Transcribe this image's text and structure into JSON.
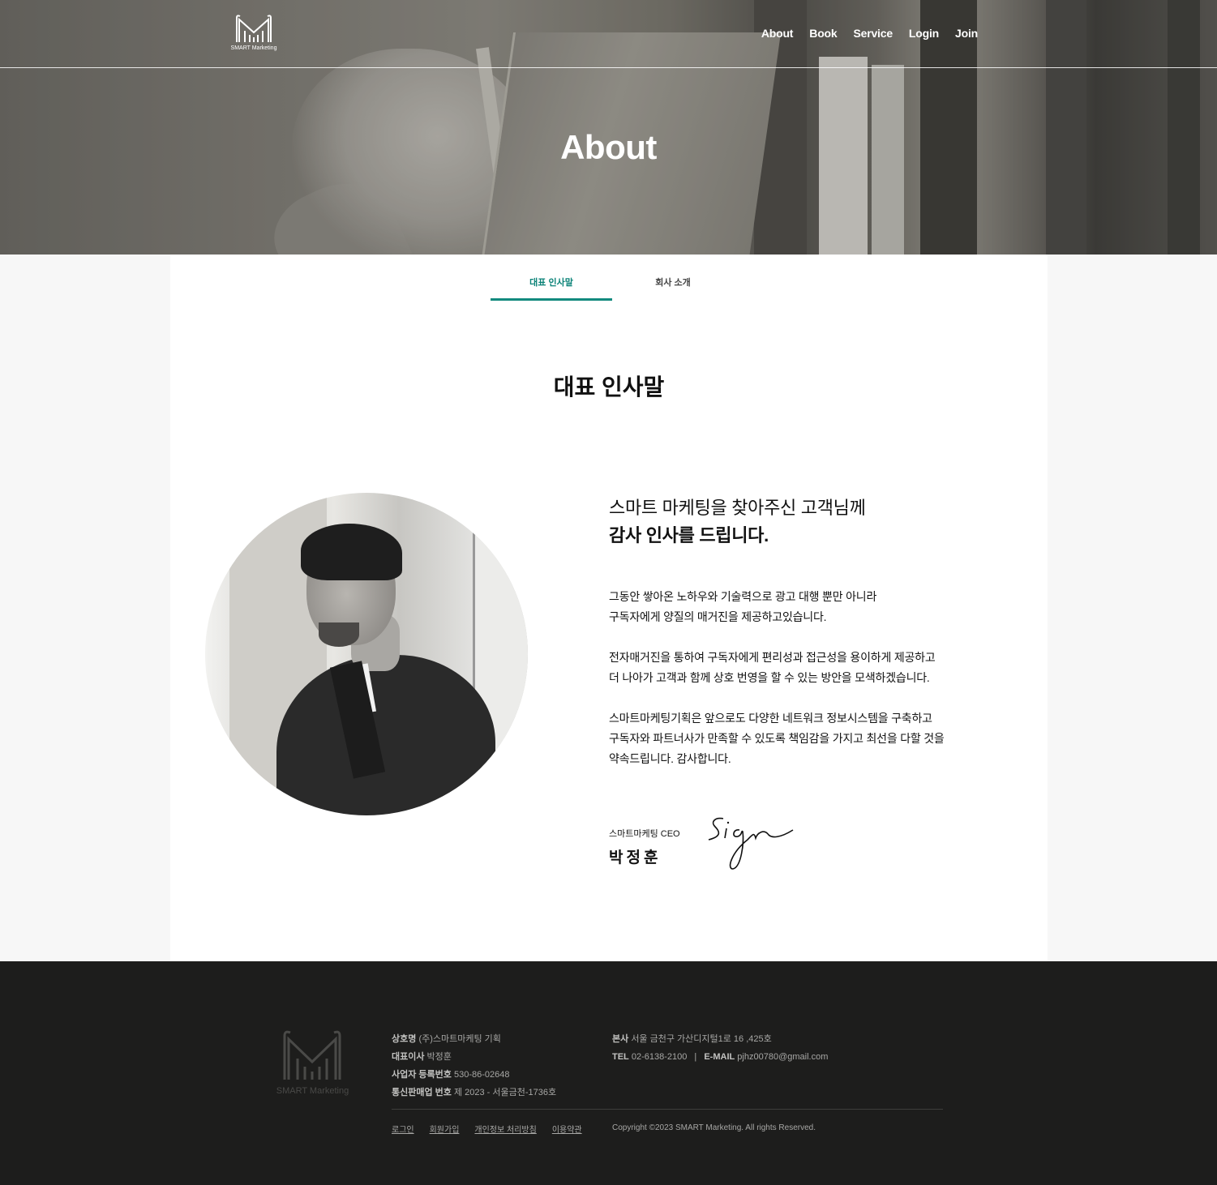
{
  "header": {
    "logo_text": "SMART Marketing",
    "nav": [
      "About",
      "Book",
      "Service",
      "Login",
      "Join"
    ],
    "hero_title": "About"
  },
  "tabs": [
    {
      "label": "대표 인사말",
      "active": true
    },
    {
      "label": "회사 소개",
      "active": false
    }
  ],
  "section": {
    "title": "대표 인사말",
    "heading_line1": "스마트 마케팅을 찾아주신 고객님께",
    "heading_line2": "감사 인사를 드립니다.",
    "paragraphs": [
      [
        "그동안 쌓아온 노하우와 기술력으로 광고 대행 뿐만 아니라",
        "구독자에게 양질의 매거진을 제공하고있습니다."
      ],
      [
        "전자매거진을 통하여 구독자에게 편리성과 접근성을 용이하게 제공하고",
        "더 나아가 고객과 함께 상호 번영을 할 수 있는 방안을 모색하겠습니다."
      ],
      [
        "스마트마케팅기획은 앞으로도 다양한 네트워크 정보시스템을 구축하고",
        "구독자와 파트너사가 만족할 수 있도록 책임감을 가지고 최선을 다할 것을",
        "약속드립니다. 감사합니다."
      ]
    ],
    "ceo_role": "스마트마케팅 CEO",
    "ceo_name": "박정훈",
    "signature_text": "Sign"
  },
  "footer": {
    "logo_text": "SMART Marketing",
    "company_label": "상호명",
    "company_value": "(주)스마트마케팅 기획",
    "ceo_label": "대표이사",
    "ceo_value": "박정훈",
    "bizno_label": "사업자 등록번호",
    "bizno_value": "530-86-02648",
    "mailorder_label": "통신판매업 번호",
    "mailorder_value": "제 2023 - 서울금천-1736호",
    "address_label": "본사",
    "address_value": "서울 금천구 가산디지털1로 16 ,425호",
    "tel_label": "TEL",
    "tel_value": "02-6138-2100",
    "email_label": "E-MAIL",
    "email_value": "pjhz00780@gmail.com",
    "links": [
      "로그인",
      "회원가입",
      "개인정보 처리방침",
      "이용약관"
    ],
    "copyright": "Copyright ©2023 SMART Marketing. All rights Reserved."
  },
  "colors": {
    "accent": "#128a7e",
    "footer_bg": "#1d1d1c"
  }
}
